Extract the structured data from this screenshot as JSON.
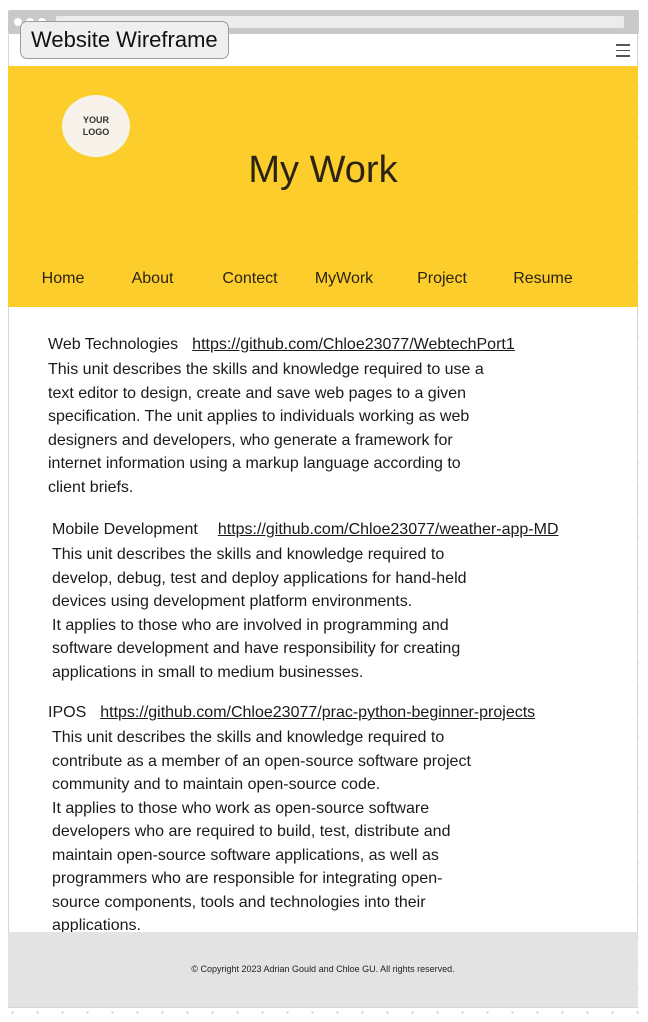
{
  "window": {
    "title": "Website Wireframe"
  },
  "header": {
    "logo_line1": "YOUR",
    "logo_line2": "LOGO",
    "title": "My Work",
    "nav": [
      "Home",
      "About",
      "Contect",
      "MyWork",
      "Project",
      "Resume"
    ]
  },
  "units": [
    {
      "name": "Web Technologies",
      "link": "https://github.com/Chloe23077/WebtechPort1",
      "description": "This unit describes the skills and knowledge required to use a text editor to design, create and save web pages to a given specification. The unit applies to individuals working as web designers and developers, who generate a framework for internet information using a markup language according to client briefs."
    },
    {
      "name": "Mobile Development",
      "link": "https://github.com/Chloe23077/weather-app-MD",
      "description": "This unit describes the skills and knowledge required to develop, debug, test and deploy applications for hand-held devices using development platform environments.",
      "description2": "It applies to those who are involved in programming and software development and have responsibility for creating applications in small to medium businesses."
    },
    {
      "name": "IPOS",
      "link": "https://github.com/Chloe23077/prac-python-beginner-projects",
      "description": "This unit describes the skills and knowledge required to contribute as a member of an open-source software project community and to maintain open-source code.",
      "description2": "It applies to those who work as open-source software developers who are required to build, test, distribute and maintain open-source software applications, as well as programmers who are responsible for integrating open-source components, tools and technologies into their applications."
    }
  ],
  "footer": {
    "copyright": "© Copyright 2023 Adrian Gould and Chloe GU. All rights reserved."
  }
}
